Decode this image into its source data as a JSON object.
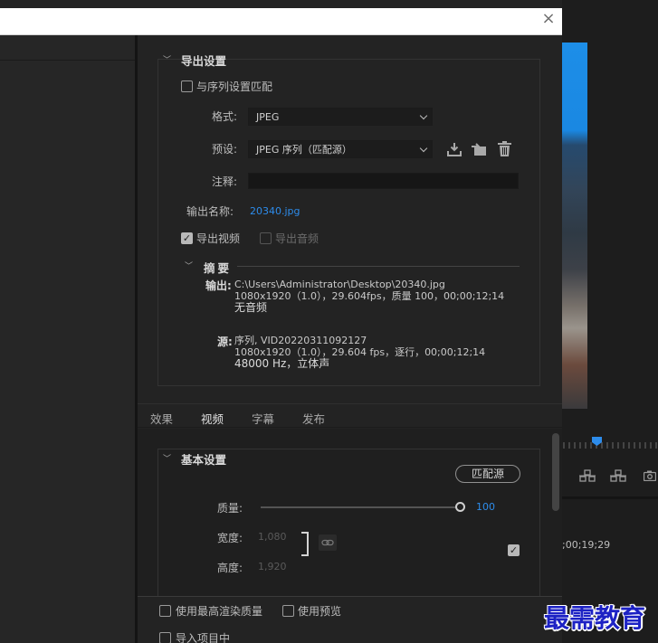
{
  "dialog": {
    "close_glyph": "×"
  },
  "export_settings": {
    "section_title": "导出设置",
    "match_sequence_label": "与序列设置匹配",
    "match_sequence_checked": false,
    "format": {
      "label": "格式:",
      "value": "JPEG"
    },
    "preset": {
      "label": "预设:",
      "value": "JPEG 序列（匹配源）"
    },
    "preset_icons": [
      "save-preset-icon",
      "import-preset-icon",
      "delete-preset-icon"
    ],
    "comments": {
      "label": "注释:",
      "value": ""
    },
    "output_name": {
      "label": "输出名称:",
      "value": "20340.jpg"
    },
    "export_video": {
      "label": "导出视频",
      "checked": true
    },
    "export_audio": {
      "label": "导出音频",
      "checked": false,
      "disabled": true
    }
  },
  "summary": {
    "title": "摘要",
    "output_label": "输出:",
    "output_lines": [
      "C:\\Users\\Administrator\\Desktop\\20340.jpg",
      "1080x1920（1.0），29.604fps，质量 100，00;00;12;14",
      "无音频"
    ],
    "source_label": "源:",
    "source_lines": [
      "序列, VID20220311092127",
      "1080x1920（1.0），29.604  fps，逐行，00;00;12;14",
      "48000 Hz，立体声"
    ]
  },
  "tabs": [
    "效果",
    "视频",
    "字幕",
    "发布"
  ],
  "active_tab": "视频",
  "basic_settings": {
    "section_title": "基本设置",
    "match_source_button": "匹配源",
    "quality": {
      "label": "质量:",
      "value": "100",
      "fraction": 1.0
    },
    "width": {
      "label": "宽度:",
      "value": "1,080"
    },
    "height": {
      "label": "高度:",
      "value": "1,920"
    },
    "link_icon": "link-icon",
    "lock_checked": true
  },
  "footer": {
    "max_render_quality": "使用最高渲染质量",
    "use_previews": "使用预览",
    "import_into_project": "导入项目中"
  },
  "timeline": {
    "timecode": ";00;19;29"
  },
  "watermark": "最需教育",
  "colors": {
    "accent": "#2d8ceb",
    "watermark": "#1d22c4",
    "panel": "#232323"
  }
}
